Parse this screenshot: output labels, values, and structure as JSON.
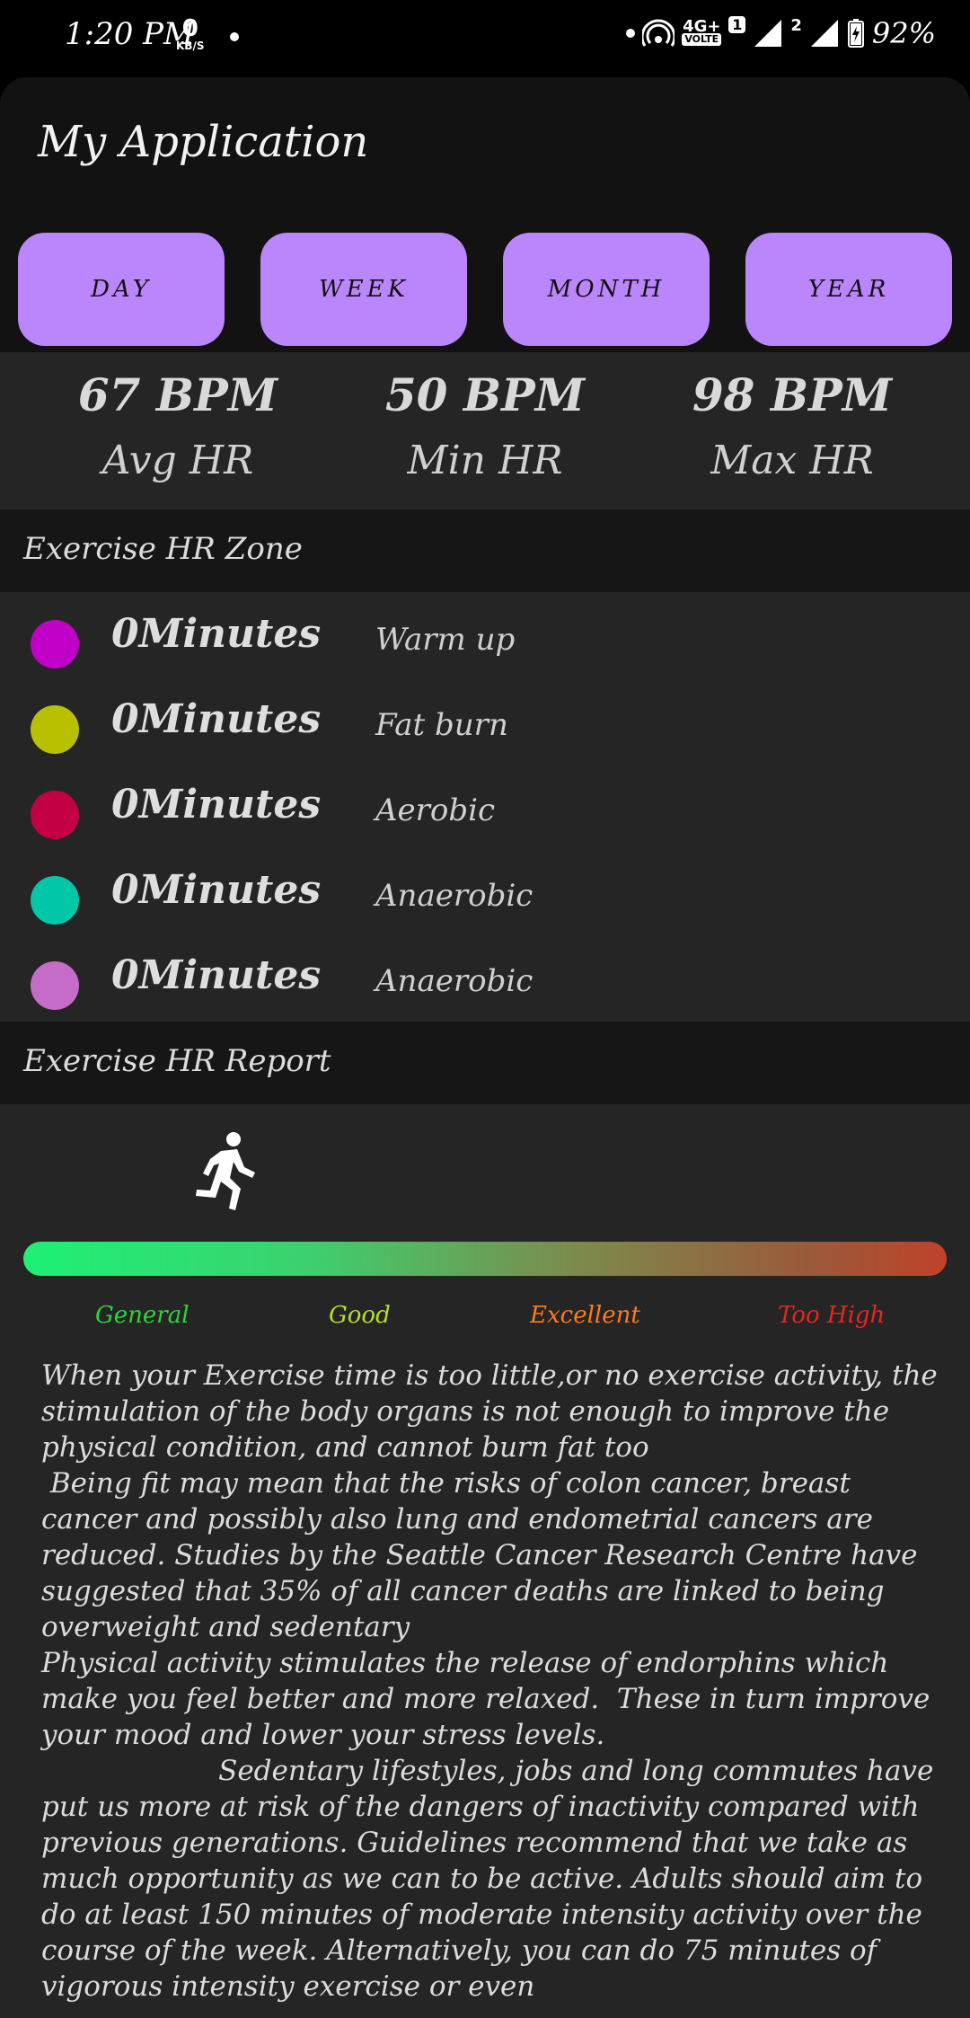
{
  "status_bar": {
    "time": "1:20 PM",
    "net_speed_value": "0",
    "net_speed_unit": "KB/S",
    "network_type": "4G+",
    "volte": "VOLTE",
    "sim1": "1",
    "sim2": "2",
    "battery": "92%"
  },
  "app": {
    "title": "My Application"
  },
  "tabs": [
    {
      "label": "DAY"
    },
    {
      "label": "WEEK"
    },
    {
      "label": "MONTH"
    },
    {
      "label": "YEAR"
    }
  ],
  "stats": [
    {
      "value": "67 BPM",
      "label": "Avg HR"
    },
    {
      "value": "50 BPM",
      "label": "Min HR"
    },
    {
      "value": "98 BPM",
      "label": "Max HR"
    }
  ],
  "zones_section": {
    "title": "Exercise HR Zone",
    "items": [
      {
        "minutes": "0Minutes",
        "name": "Warm up",
        "color": "#c000c8"
      },
      {
        "minutes": "0Minutes",
        "name": "Fat burn",
        "color": "#b9c000"
      },
      {
        "minutes": "0Minutes",
        "name": "Aerobic",
        "color": "#c40044"
      },
      {
        "minutes": "0Minutes",
        "name": "Anaerobic",
        "color": "#00c7a7"
      },
      {
        "minutes": "0Minutes",
        "name": "Anaerobic",
        "color": "#c46cc8"
      }
    ]
  },
  "report_section": {
    "title": "Exercise HR Report",
    "runner_icon": "running-person-icon",
    "bar_labels": [
      {
        "text": "General",
        "color": "#2bd63a"
      },
      {
        "text": "Good",
        "color": "#b2e02c"
      },
      {
        "text": "Excellent",
        "color": "#ff7a1a"
      },
      {
        "text": "Too High",
        "color": "#e8261e"
      }
    ],
    "paragraph": "When your Exercise time is too little,or no exercise activity, the stimulation of the body organs is not enough to improve the physical condition, and cannot burn fat too\n Being fit may mean that the risks of colon cancer, breast cancer and possibly also lung and endometrial cancers are reduced. Studies by the Seattle Cancer Research Centre have suggested that 35% of all cancer deaths are linked to being overweight and sedentary\nPhysical activity stimulates the release of endorphins which make you feel better and more relaxed.  These in turn improve your mood and lower your stress levels.\n                    Sedentary lifestyles, jobs and long commutes have put us more at risk of the dangers of inactivity compared with previous generations. Guidelines recommend that we take as much opportunity as we can to be active. Adults should aim to do at least 150 minutes of moderate intensity activity over the course of the week. Alternatively, you can do 75 minutes of vigorous intensity exercise or even"
  }
}
